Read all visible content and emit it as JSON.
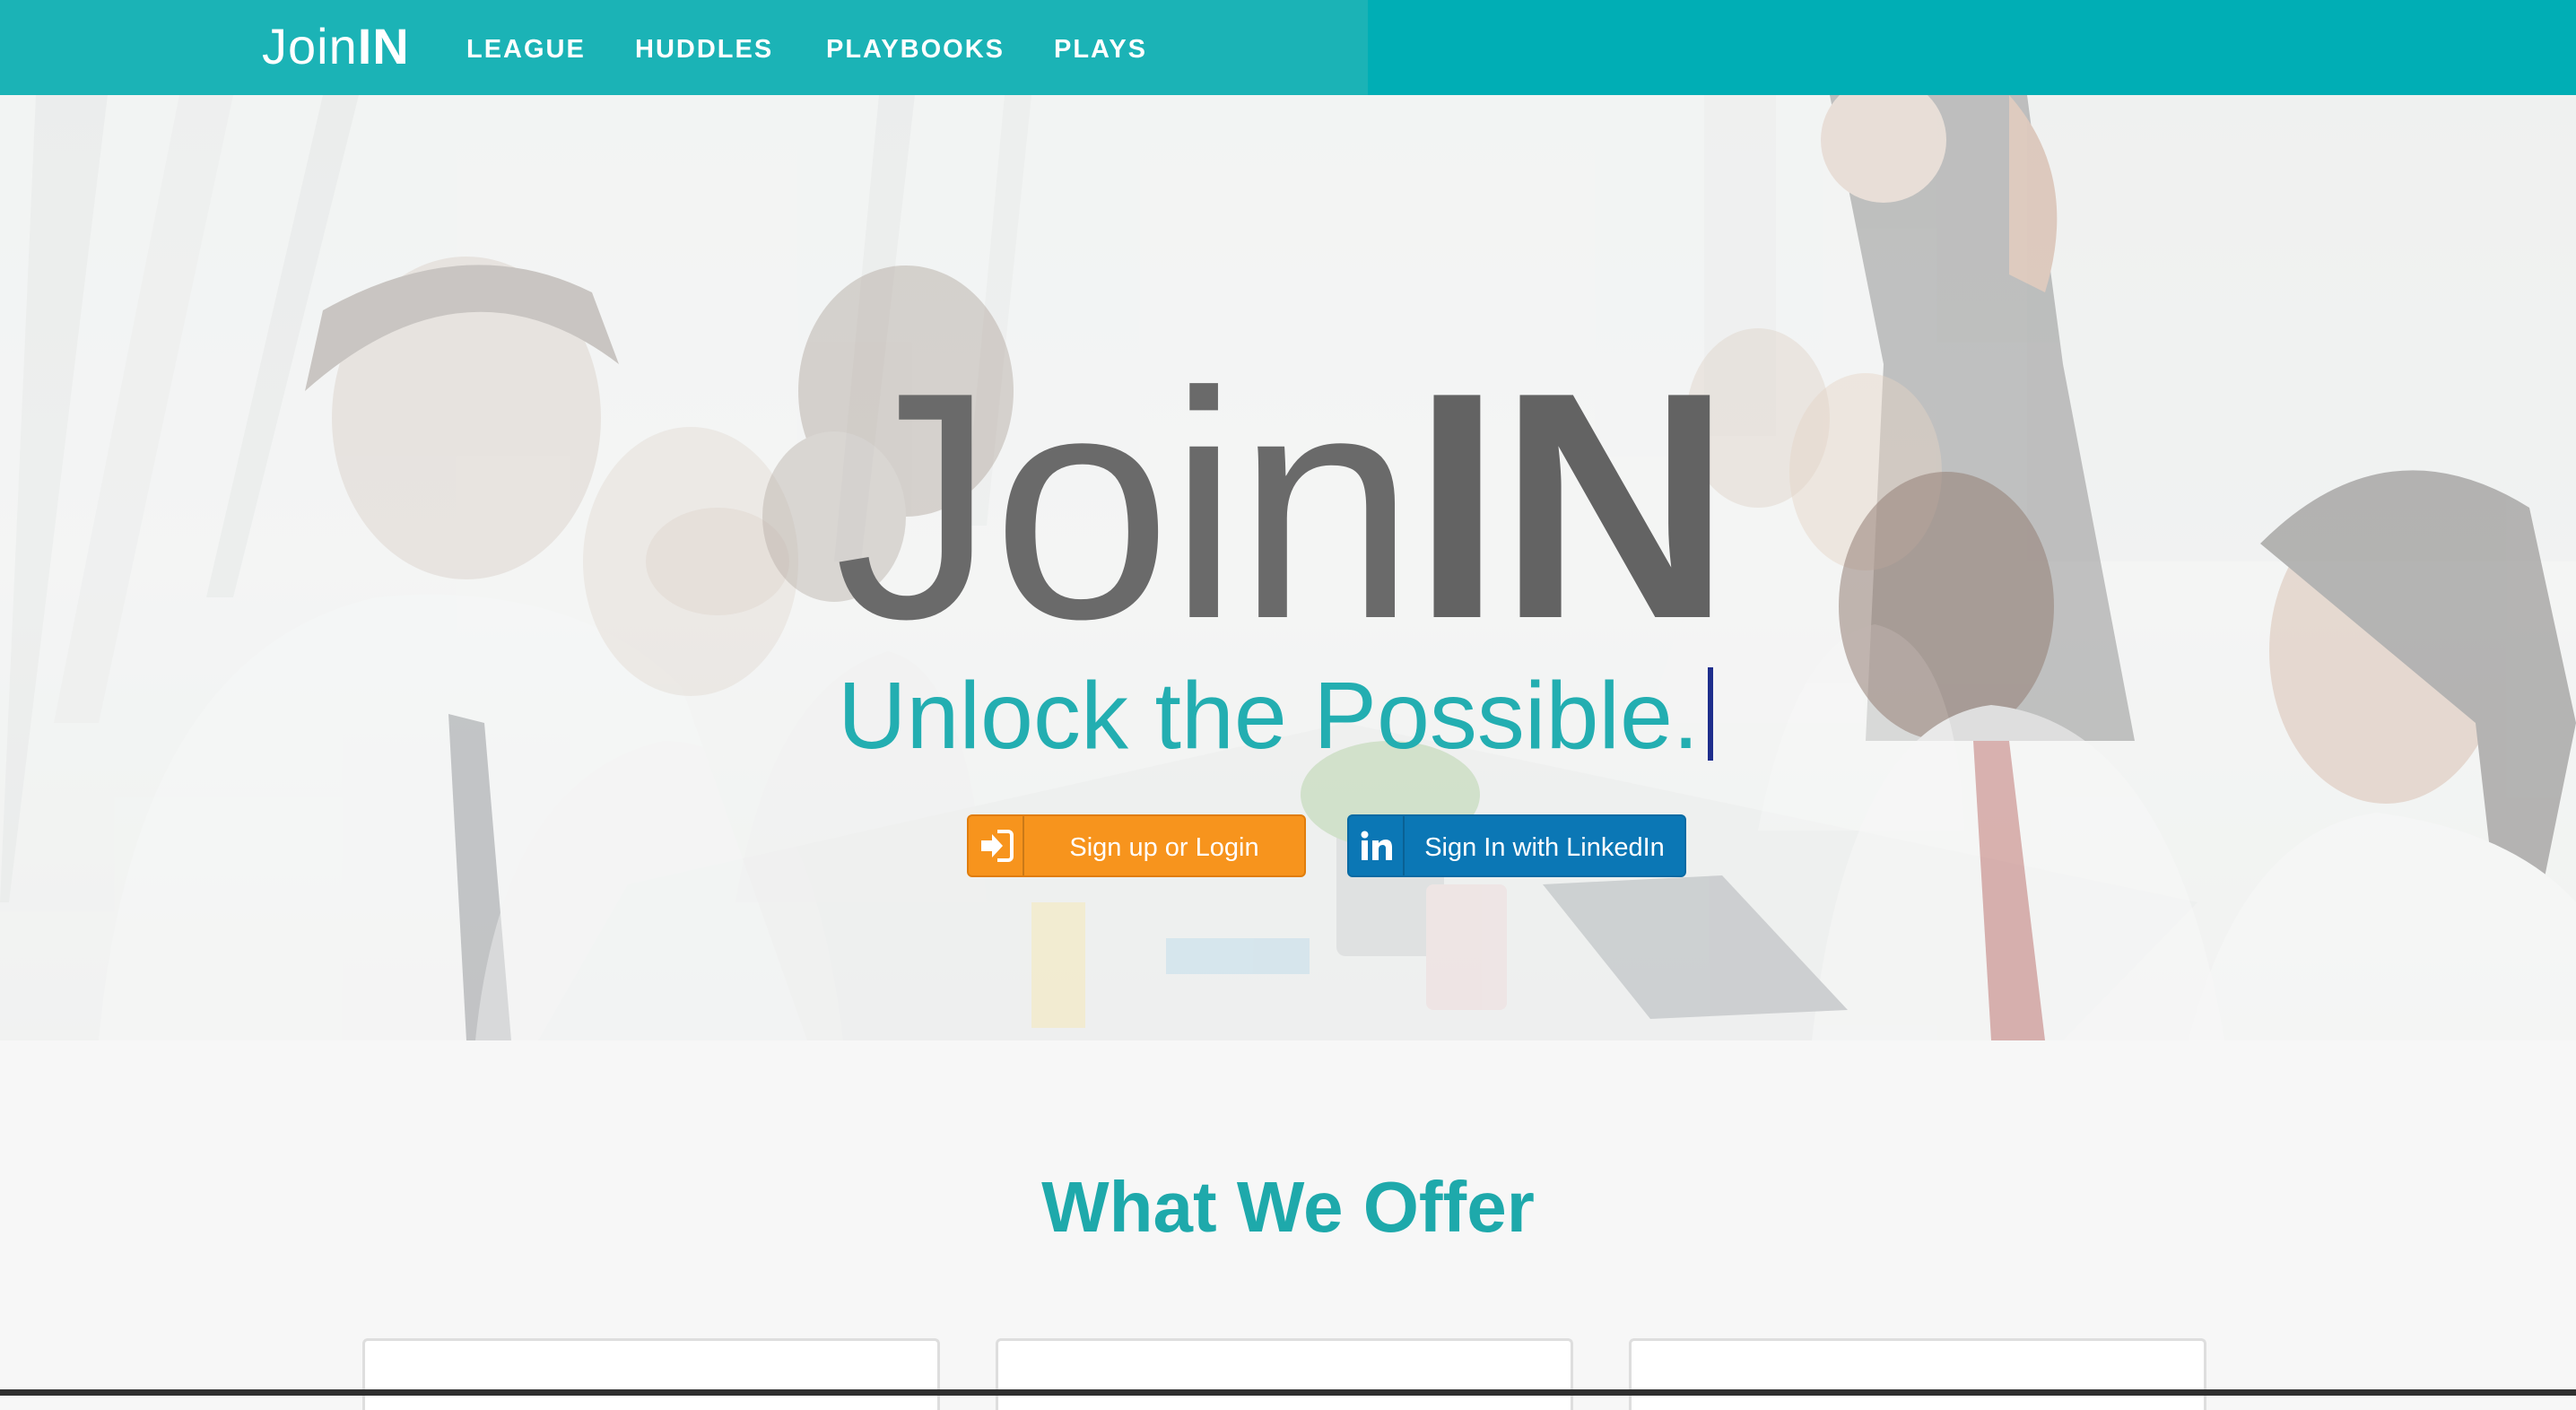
{
  "navbar": {
    "brand_light": "Join",
    "brand_bold": "IN",
    "items": [
      {
        "label": "LEAGUE"
      },
      {
        "label": "HUDDLES"
      },
      {
        "label": "PLAYBOOKS"
      },
      {
        "label": "PLAYS"
      }
    ]
  },
  "hero": {
    "title_light": "Join",
    "title_bold": "IN",
    "tagline": "Unlock the Possible.",
    "signup_button": {
      "label": "Sign up or Login",
      "icon": "sign-in-icon"
    },
    "linkedin_button": {
      "label": "Sign In with LinkedIn",
      "icon": "linkedin-icon"
    }
  },
  "offer": {
    "title": "What We Offer",
    "cards": [
      {},
      {},
      {}
    ]
  },
  "colors": {
    "teal": "#00aeb5",
    "teal_text": "#23aeb1",
    "orange": "#f7941d",
    "linkedin_blue": "#0b77b5",
    "title_grey": "#6a6a6a"
  }
}
